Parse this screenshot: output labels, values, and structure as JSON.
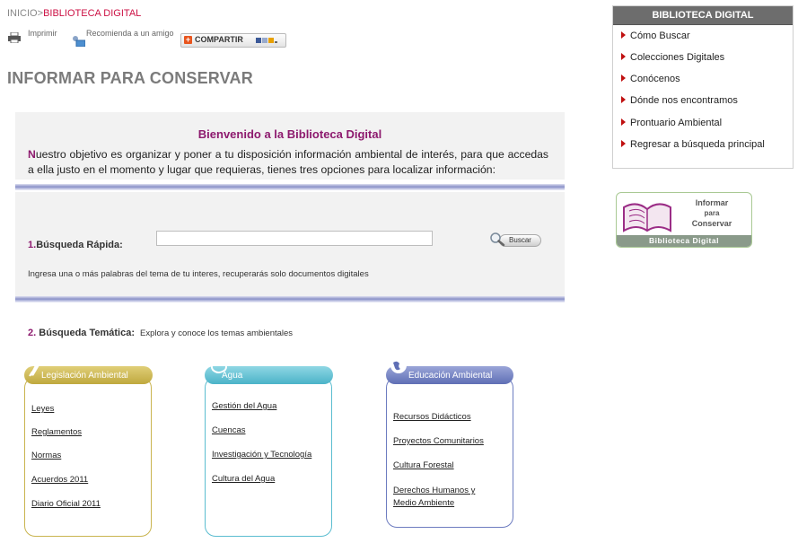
{
  "breadcrumb": {
    "home": "INICIO",
    "separator": ">",
    "current": "BIBLIOTECA DIGITAL"
  },
  "tools": {
    "print": "Imprimir",
    "recommend": "Recomienda a un amigo",
    "share": "COMPARTIR"
  },
  "page_title": "INFORMAR PARA CONSERVAR",
  "welcome": {
    "title": "Bienvenido a la Biblioteca Digital",
    "first_letter": "N",
    "text": "uestro objetivo es organizar y poner a tu disposición información ambiental de interés, para que accedas a ella justo en el momento y lugar que requieras, tienes tres opciones para localizar información:"
  },
  "quick_search": {
    "number": "1.",
    "label": "Búsqueda Rápida:",
    "value": "",
    "button": "Buscar",
    "help": "Ingresa una o más palabras del tema de tu interes, recuperarás solo documentos digitales"
  },
  "thematic": {
    "number": "2.",
    "label": "Búsqueda Temática:",
    "sub": "Explora y conoce los temas ambientales"
  },
  "categories": [
    {
      "title": "Legislación Ambiental",
      "color": "#c9b44f",
      "links": [
        "Leyes",
        "Reglamentos",
        "Normas",
        "Acuerdos 2011",
        "Diario Oficial 2011"
      ]
    },
    {
      "title": "Agua",
      "color": "#5bbdd0",
      "links": [
        "Gestión del Agua",
        "Cuencas",
        "Investigación y Tecnología",
        "Cultura del Agua"
      ]
    },
    {
      "title": "Educación Ambiental",
      "color": "#6d7cc0",
      "links": [
        "Recursos Didácticos",
        "Proyectos Comunitarios",
        "Cultura Forestal",
        "Derechos Humanos y",
        "Medio Ambiente"
      ]
    }
  ],
  "sidebar": {
    "title": "BIBLIOTECA DIGITAL",
    "items": [
      "Cómo Buscar",
      "Colecciones Digitales",
      "Conócenos",
      "Dónde nos encontramos",
      "Prontuario Ambiental",
      "Regresar a búsqueda principal"
    ]
  },
  "logo": {
    "line1": "Informar",
    "line2": "para",
    "line3": "Conservar",
    "band": "Biblioteca Digital"
  },
  "colors": {
    "accent": "#8d1a6e",
    "breadcrumb_current": "#cc1144",
    "sidebar_header": "#6d6d6d",
    "bullet": "#c01010"
  }
}
